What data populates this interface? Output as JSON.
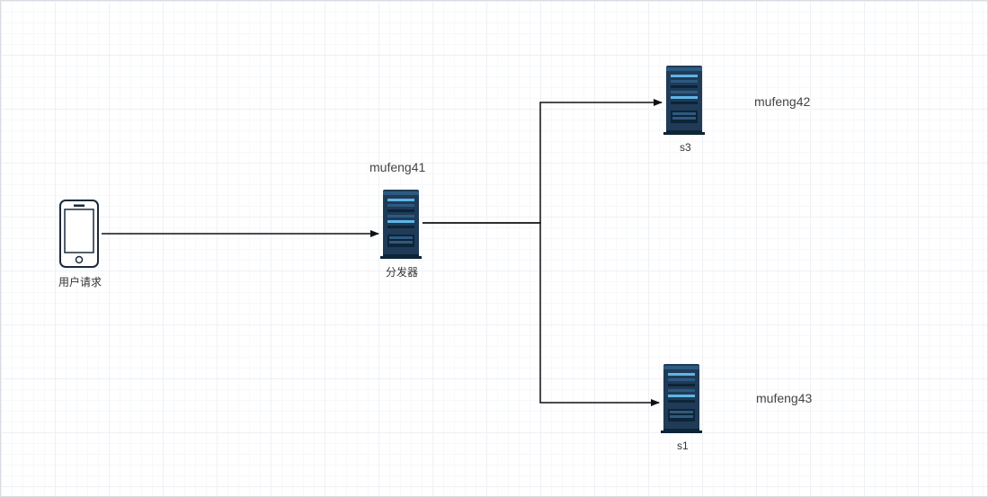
{
  "nodes": {
    "client": {
      "caption": "用户请求"
    },
    "dispatcher": {
      "title": "mufeng41",
      "caption": "分发器"
    },
    "server_s3": {
      "title": "mufeng42",
      "caption": "s3"
    },
    "server_s1": {
      "title": "mufeng43",
      "caption": "s1"
    }
  },
  "chart_data": {
    "type": "diagram",
    "nodes": [
      {
        "id": "client",
        "type": "phone",
        "label": "用户请求"
      },
      {
        "id": "dispatcher",
        "type": "server",
        "title": "mufeng41",
        "label": "分发器"
      },
      {
        "id": "s3",
        "type": "server",
        "title": "mufeng42",
        "label": "s3"
      },
      {
        "id": "s1",
        "type": "server",
        "title": "mufeng43",
        "label": "s1"
      }
    ],
    "edges": [
      {
        "from": "client",
        "to": "dispatcher",
        "style": "arrow"
      },
      {
        "from": "dispatcher",
        "to": "s3",
        "style": "arrow"
      },
      {
        "from": "dispatcher",
        "to": "s1",
        "style": "arrow"
      }
    ]
  }
}
